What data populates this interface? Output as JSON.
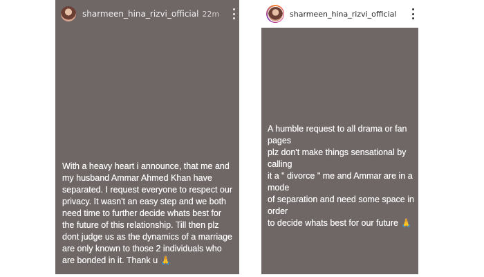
{
  "stories": {
    "left": {
      "username": "sharmeen_hina_rizvi_official",
      "timestamp": "22m",
      "text": "With a heavy heart i announce, that me and\nmy husband Ammar Ahmed Khan have\nseparated. I request everyone to respect our\nprivacy. It wasn't an easy step and we both\nneed time to further decide whats best for\nthe future of this relationship. Till then plz\ndont judge us as the dynamics of a marriage\nare only known to those 2 individuals who\nare bonded in it. Thank u",
      "emoji": "🙏"
    },
    "right": {
      "username": "sharmeen_hina_rizvi_official",
      "text": "A humble request to all drama or fan pages\nplz don't make things sensational by calling\nit a \" divorce \" me and Ammar are in a mode\nof separation and need some space in order\nto decide whats best for our future",
      "emoji": "🙏"
    }
  },
  "colors": {
    "story_background": "#6f6666",
    "page_background": "#ffffff",
    "header_right_background": "#ffffff"
  },
  "icons": {
    "more": "more-vertical-icon",
    "avatar": "profile-avatar",
    "emoji": "folded-hands-emoji"
  }
}
